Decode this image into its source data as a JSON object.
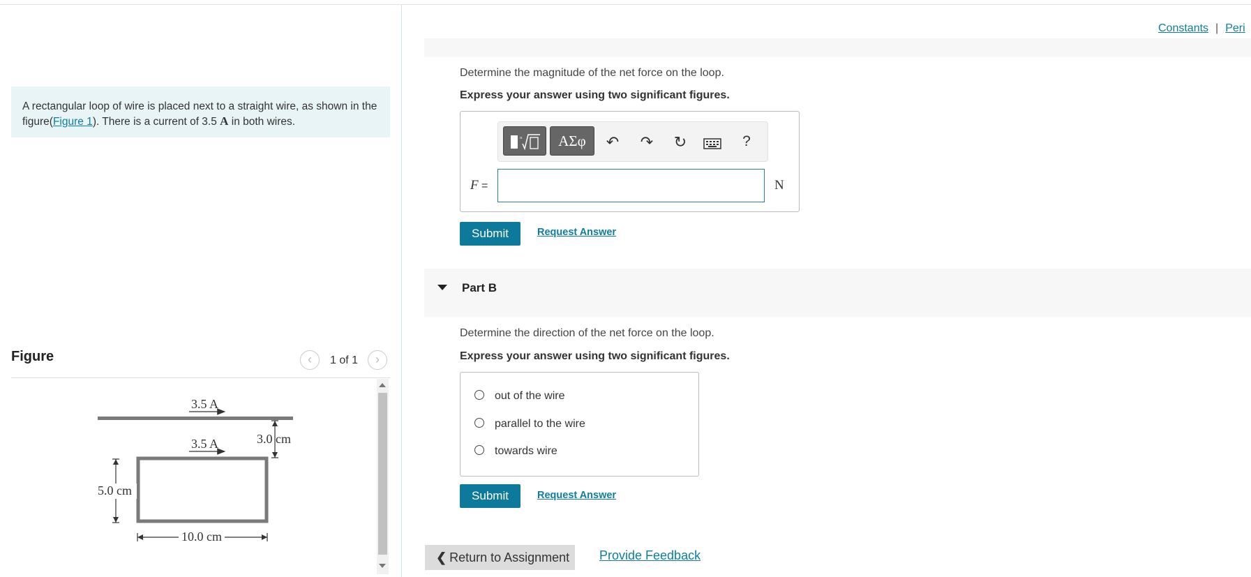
{
  "left": {
    "intro": {
      "text_before": "A rectangular loop of wire is placed next to a straight wire, as shown in the figure(",
      "figure_link": "Figure 1",
      "text_mid": "). There is a current of 3.5 ",
      "unit": "A",
      "text_after": " in both wires."
    },
    "figure": {
      "title": "Figure",
      "prev_icon": "chevron-left-icon",
      "next_icon": "chevron-right-icon",
      "pager": "1 of 1",
      "labels": {
        "top_current": "3.5 A",
        "loop_current": "3.5 A",
        "gap": "3.0 cm",
        "height": "5.0 cm",
        "width": "10.0 cm"
      }
    }
  },
  "header": {
    "constants": "Constants",
    "separator": "|",
    "periodic": "Peri"
  },
  "part_a": {
    "question": "Determine the magnitude of the net force on the loop.",
    "instruction": "Express your answer using two significant figures.",
    "toolbar": {
      "templates_icon": "templates-icon",
      "greek": "ΑΣφ",
      "undo_icon": "undo-icon",
      "redo_icon": "redo-icon",
      "reset_icon": "reset-icon",
      "keyboard_icon": "keyboard-icon",
      "help": "?"
    },
    "variable": "F",
    "equals": " =",
    "input_value": "",
    "unit": "N",
    "submit": "Submit",
    "request": "Request Answer"
  },
  "part_b": {
    "title": "Part B",
    "question": "Determine the direction of the net force on the loop.",
    "instruction": "Express your answer using two significant figures.",
    "options": [
      "out of the wire",
      "parallel to the wire",
      "towards wire"
    ],
    "submit": "Submit",
    "request": "Request Answer"
  },
  "footer": {
    "return": "Return to Assignment",
    "feedback": "Provide Feedback"
  }
}
